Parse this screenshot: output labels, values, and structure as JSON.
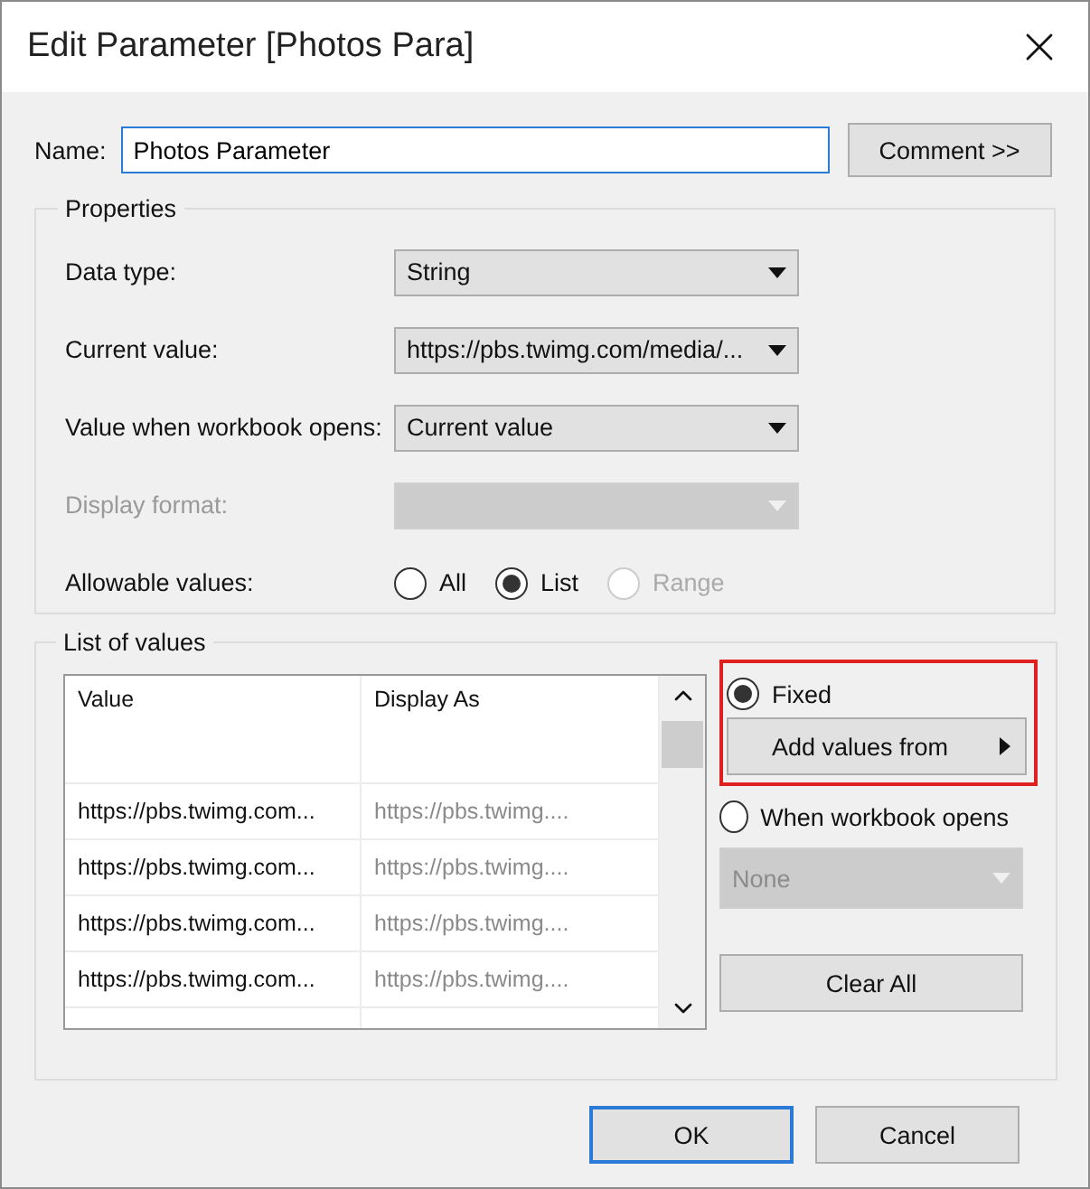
{
  "window": {
    "title": "Edit Parameter [Photos Para]"
  },
  "name_field": {
    "label": "Name:",
    "value": "Photos Parameter"
  },
  "comment_button": {
    "label": "Comment >>"
  },
  "properties": {
    "title": "Properties",
    "fields": [
      {
        "label": "Data type:",
        "value": "String",
        "disabled": false
      },
      {
        "label": "Current value:",
        "value": "https://pbs.twimg.com/media/...",
        "disabled": false
      },
      {
        "label": "Value when workbook opens:",
        "value": "Current value",
        "disabled": false
      },
      {
        "label": "Display format:",
        "disabled": true
      }
    ],
    "allowable": {
      "label": "Allowable values:",
      "options": [
        {
          "label": "All",
          "selected": false,
          "disabled": false
        },
        {
          "label": "List",
          "selected": true,
          "disabled": false
        },
        {
          "label": "Range",
          "selected": false,
          "disabled": true
        }
      ]
    }
  },
  "list_of_values": {
    "title": "List of values",
    "table": {
      "columns": [
        "Value",
        "Display As"
      ],
      "rows": [
        {
          "cells": [
            "https://pbs.twimg.com...",
            "https://pbs.twimg...."
          ]
        },
        {
          "cells": [
            "https://pbs.twimg.com...",
            "https://pbs.twimg...."
          ]
        },
        {
          "cells": [
            "https://pbs.twimg.com...",
            "https://pbs.twimg...."
          ]
        },
        {
          "cells": [
            "https://pbs.twimg.com...",
            "https://pbs.twimg...."
          ]
        }
      ]
    },
    "fixed": {
      "label": "Fixed",
      "selected": true,
      "highlighted": true
    },
    "add_values_button": {
      "label": "Add values from"
    },
    "when_opens": {
      "label": "When workbook opens",
      "selected": false
    },
    "source_dropdown": {
      "value": "None",
      "disabled": true
    },
    "clear_all_button": {
      "label": "Clear All"
    }
  },
  "buttons": [
    {
      "label": "OK",
      "default": true
    },
    {
      "label": "Cancel",
      "default": false
    }
  ]
}
